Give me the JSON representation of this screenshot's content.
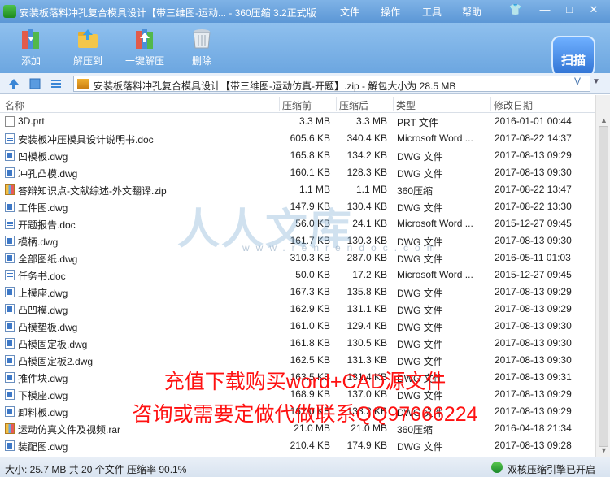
{
  "titlebar": {
    "title": "安装板落料冲孔复合模具设计【带三维图-运动... - 360压缩 3.2正式版",
    "menu": [
      "文件",
      "操作",
      "工具",
      "帮助"
    ],
    "controls": {
      "skin": "👕",
      "minimize": "—",
      "maximize": "□",
      "close": "✕"
    }
  },
  "toolbar": {
    "add": "添加",
    "extract": "解压到",
    "one_click": "一键解压",
    "delete": "删除",
    "scan": "扫描"
  },
  "address": {
    "path": "安装板落料冲孔复合模具设计【带三维图-运动仿真-开题】.zip - 解包大小为 28.5 MB",
    "chevron": "V",
    "arrow": "▼"
  },
  "columns": {
    "name": "名称",
    "size": "压缩前",
    "packed": "压缩后",
    "type": "类型",
    "modified": "修改日期"
  },
  "files": [
    {
      "name": "3D.prt",
      "size": "3.3 MB",
      "packed": "3.3 MB",
      "type": "PRT 文件",
      "date": "2016-01-01 00:44",
      "icon": "prt"
    },
    {
      "name": "安装板冲压模具设计说明书.doc",
      "size": "605.6 KB",
      "packed": "340.4 KB",
      "type": "Microsoft Word ...",
      "date": "2017-08-22 14:37",
      "icon": "doc"
    },
    {
      "name": "凹模板.dwg",
      "size": "165.8 KB",
      "packed": "134.2 KB",
      "type": "DWG 文件",
      "date": "2017-08-13 09:29",
      "icon": "dwg"
    },
    {
      "name": "冲孔凸模.dwg",
      "size": "160.1 KB",
      "packed": "128.3 KB",
      "type": "DWG 文件",
      "date": "2017-08-13 09:30",
      "icon": "dwg"
    },
    {
      "name": "答辩知识点-文献综述-外文翻译.zip",
      "size": "1.1 MB",
      "packed": "1.1 MB",
      "type": "360压缩",
      "date": "2017-08-22 13:47",
      "icon": "zip"
    },
    {
      "name": "工件图.dwg",
      "size": "147.9 KB",
      "packed": "130.4 KB",
      "type": "DWG 文件",
      "date": "2017-08-22 13:30",
      "icon": "dwg"
    },
    {
      "name": "开题报告.doc",
      "size": "56.0 KB",
      "packed": "24.1 KB",
      "type": "Microsoft Word ...",
      "date": "2015-12-27 09:45",
      "icon": "doc"
    },
    {
      "name": "模柄.dwg",
      "size": "161.7 KB",
      "packed": "130.3 KB",
      "type": "DWG 文件",
      "date": "2017-08-13 09:30",
      "icon": "dwg"
    },
    {
      "name": "全部图纸.dwg",
      "size": "310.3 KB",
      "packed": "287.0 KB",
      "type": "DWG 文件",
      "date": "2016-05-11 01:03",
      "icon": "dwg"
    },
    {
      "name": "任务书.doc",
      "size": "50.0 KB",
      "packed": "17.2 KB",
      "type": "Microsoft Word ...",
      "date": "2015-12-27 09:45",
      "icon": "doc"
    },
    {
      "name": "上模座.dwg",
      "size": "167.3 KB",
      "packed": "135.8 KB",
      "type": "DWG 文件",
      "date": "2017-08-13 09:29",
      "icon": "dwg"
    },
    {
      "name": "凸凹模.dwg",
      "size": "162.9 KB",
      "packed": "131.1 KB",
      "type": "DWG 文件",
      "date": "2017-08-13 09:29",
      "icon": "dwg"
    },
    {
      "name": "凸模垫板.dwg",
      "size": "161.0 KB",
      "packed": "129.4 KB",
      "type": "DWG 文件",
      "date": "2017-08-13 09:30",
      "icon": "dwg"
    },
    {
      "name": "凸模固定板.dwg",
      "size": "161.8 KB",
      "packed": "130.5 KB",
      "type": "DWG 文件",
      "date": "2017-08-13 09:30",
      "icon": "dwg"
    },
    {
      "name": "凸模固定板2.dwg",
      "size": "162.5 KB",
      "packed": "131.3 KB",
      "type": "DWG 文件",
      "date": "2017-08-13 09:30",
      "icon": "dwg"
    },
    {
      "name": "推件块.dwg",
      "size": "163.5 KB",
      "packed": "131.4 KB",
      "type": "DWG 文件",
      "date": "2017-08-13 09:31",
      "icon": "dwg"
    },
    {
      "name": "下模座.dwg",
      "size": "168.9 KB",
      "packed": "137.0 KB",
      "type": "DWG 文件",
      "date": "2017-08-13 09:29",
      "icon": "dwg"
    },
    {
      "name": "卸料板.dwg",
      "size": "162.0 KB",
      "packed": "133.2 KB",
      "type": "DWG 文件",
      "date": "2017-08-13 09:29",
      "icon": "dwg"
    },
    {
      "name": "运动仿真文件及视频.rar",
      "size": "21.0 MB",
      "packed": "21.0 MB",
      "type": "360压缩",
      "date": "2016-04-18 21:34",
      "icon": "zip"
    },
    {
      "name": "装配图.dwg",
      "size": "210.4 KB",
      "packed": "174.9 KB",
      "type": "DWG 文件",
      "date": "2017-08-13 09:28",
      "icon": "dwg"
    }
  ],
  "overlay": {
    "watermark": "人人文库",
    "watermark_url": "www.renrendoc.com",
    "promo_line1": "充值下载购买word+CAD源文件",
    "promo_line2": "咨询或需要定做代做联系QQ97666224"
  },
  "status": {
    "summary": "大小: 25.7 MB 共 20 个文件 压缩率 90.1%",
    "engine": "双核压缩引擎已开启"
  },
  "colors": {
    "toolbar_top": "#8fc0ee",
    "toolbar_bottom": "#6ca6e0",
    "promo": "#ff1111",
    "watermark": "#78aad2"
  }
}
